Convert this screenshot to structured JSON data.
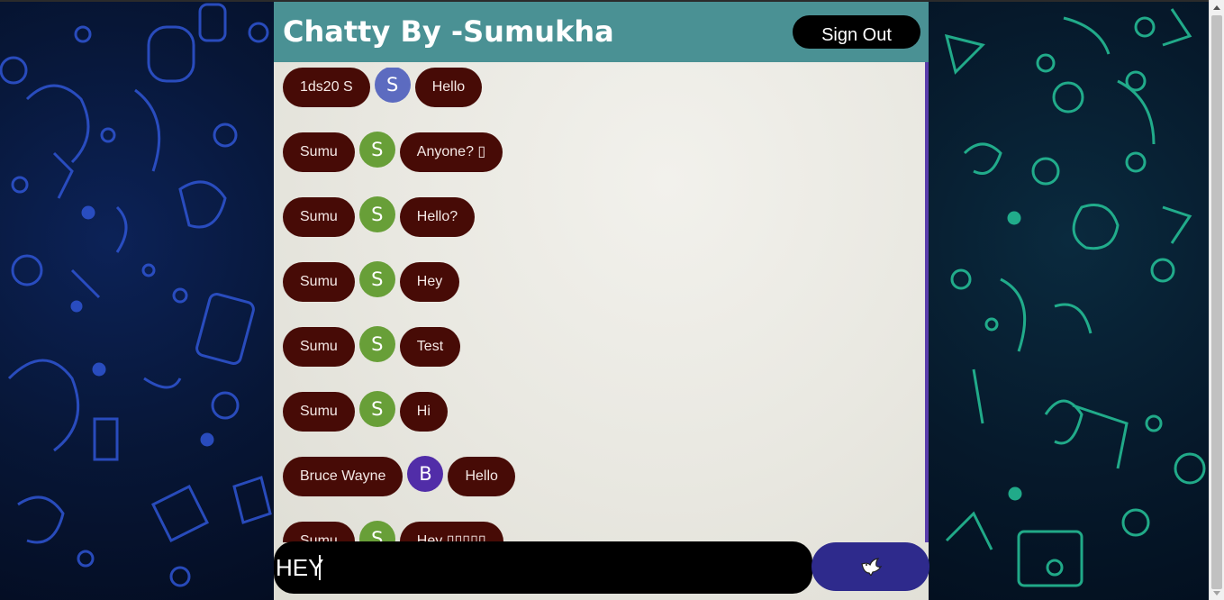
{
  "header": {
    "title": "Chatty By -Sumukha",
    "sign_out_label": "Sign Out"
  },
  "messages": [
    {
      "user": "1ds20 S",
      "initial": "S",
      "text": "Hello",
      "avatar_color": "#5c6bc0"
    },
    {
      "user": "Sumu",
      "initial": "S",
      "text": "Anyone? ▯",
      "avatar_color": "#689f38"
    },
    {
      "user": "Sumu",
      "initial": "S",
      "text": "Hello?",
      "avatar_color": "#689f38"
    },
    {
      "user": "Sumu",
      "initial": "S",
      "text": "Hey",
      "avatar_color": "#689f38"
    },
    {
      "user": "Sumu",
      "initial": "S",
      "text": "Test",
      "avatar_color": "#689f38"
    },
    {
      "user": "Sumu",
      "initial": "S",
      "text": "Hi",
      "avatar_color": "#689f38"
    },
    {
      "user": "Bruce Wayne",
      "initial": "B",
      "text": "Hello",
      "avatar_color": "#512da8"
    },
    {
      "user": "Sumu",
      "initial": "S",
      "text": "Hey ▯▯▯▯▯",
      "avatar_color": "#689f38"
    }
  ],
  "composer": {
    "value": "HEY",
    "send_icon": "dove-icon"
  },
  "colors": {
    "header_bg": "#4a9194",
    "pill_bg": "#470b06",
    "send_bg": "#2e2a8c"
  }
}
